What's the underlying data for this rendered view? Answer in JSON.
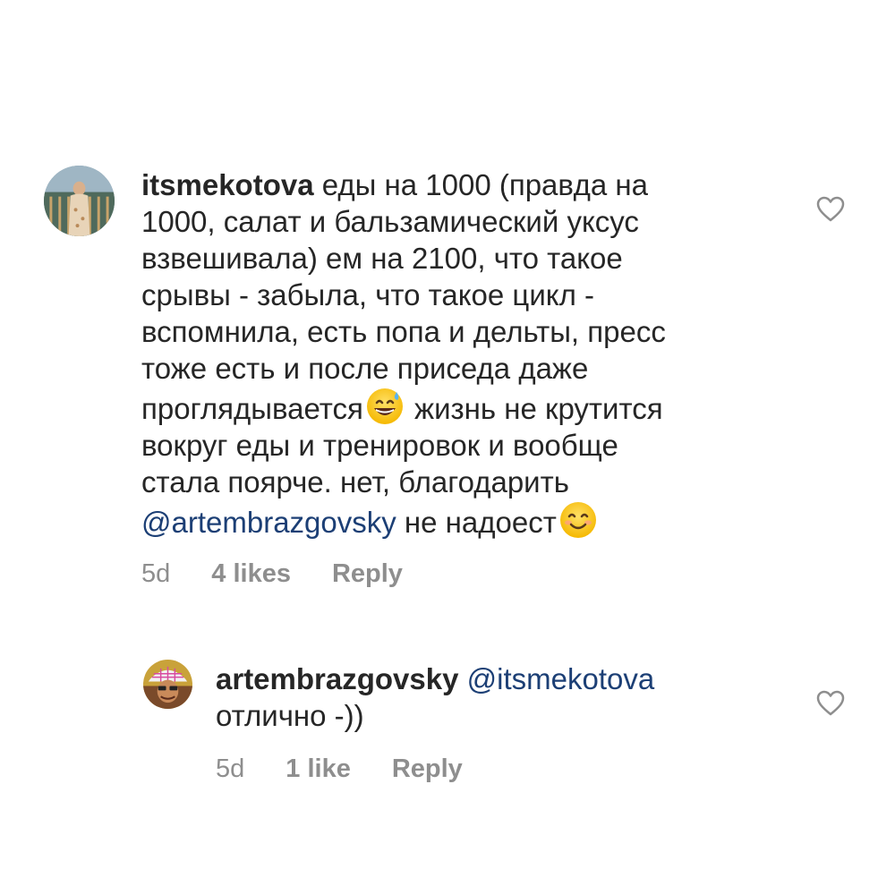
{
  "comments": [
    {
      "username": "itsmekotova",
      "text_part1": " еды на 1000 (правда на\n1000, салат и бальзамический уксус\nвзвешивала) ем на 2100, что такое\nсрывы - забыла, что такое цикл -\nвспомнила, есть попа и дельты, пресс\nтоже есть и после приседа даже\nпроглядывается",
      "emoji1": "grinning-sweat-emoji",
      "text_part2": " жизнь не крутится\nвокруг еды и тренировок и вообще\nстала поярче. нет, благодарить\n",
      "mention": "@artembrazgovsky",
      "text_part3": " не надоест",
      "emoji2": "smiling-blush-emoji",
      "time": "5d",
      "likes": "4 likes",
      "reply": "Reply",
      "like_icon": "heart-outline-icon"
    },
    {
      "username": "artembrazgovsky",
      "mention": "@itsmekotova",
      "text": "отлично -))",
      "time": "5d",
      "likes": "1 like",
      "reply": "Reply",
      "like_icon": "heart-outline-icon"
    }
  ],
  "colors": {
    "text": "#262626",
    "meta": "#8e8e8e",
    "mention": "#1c3f75",
    "heart": "#8e8e8e"
  }
}
